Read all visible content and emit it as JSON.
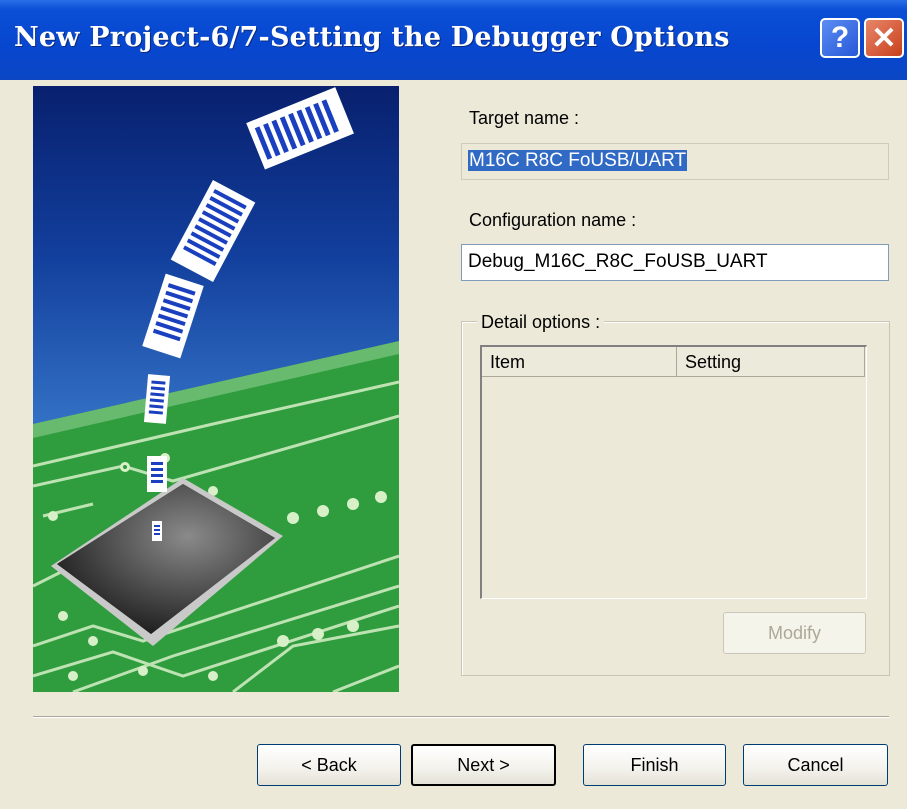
{
  "window": {
    "title": "New Project-6/7-Setting the Debugger Options"
  },
  "titlebar": {
    "help_label": "?",
    "close_label": "✕"
  },
  "target": {
    "label": "Target name :",
    "value": "M16C R8C FoUSB/UART"
  },
  "configuration": {
    "label": "Configuration name :",
    "value": "Debug_M16C_R8C_FoUSB_UART"
  },
  "detail": {
    "label": "Detail options :",
    "columns": [
      "Item",
      "Setting"
    ],
    "modify_label": "Modify"
  },
  "buttons": {
    "back": "< Back",
    "next": "Next >",
    "finish": "Finish",
    "cancel": "Cancel"
  },
  "colors": {
    "title_bar": "#0746cf",
    "selection": "#316ac5",
    "dialog_bg": "#ece9d8",
    "pcb_green": "#2e9a3e"
  }
}
